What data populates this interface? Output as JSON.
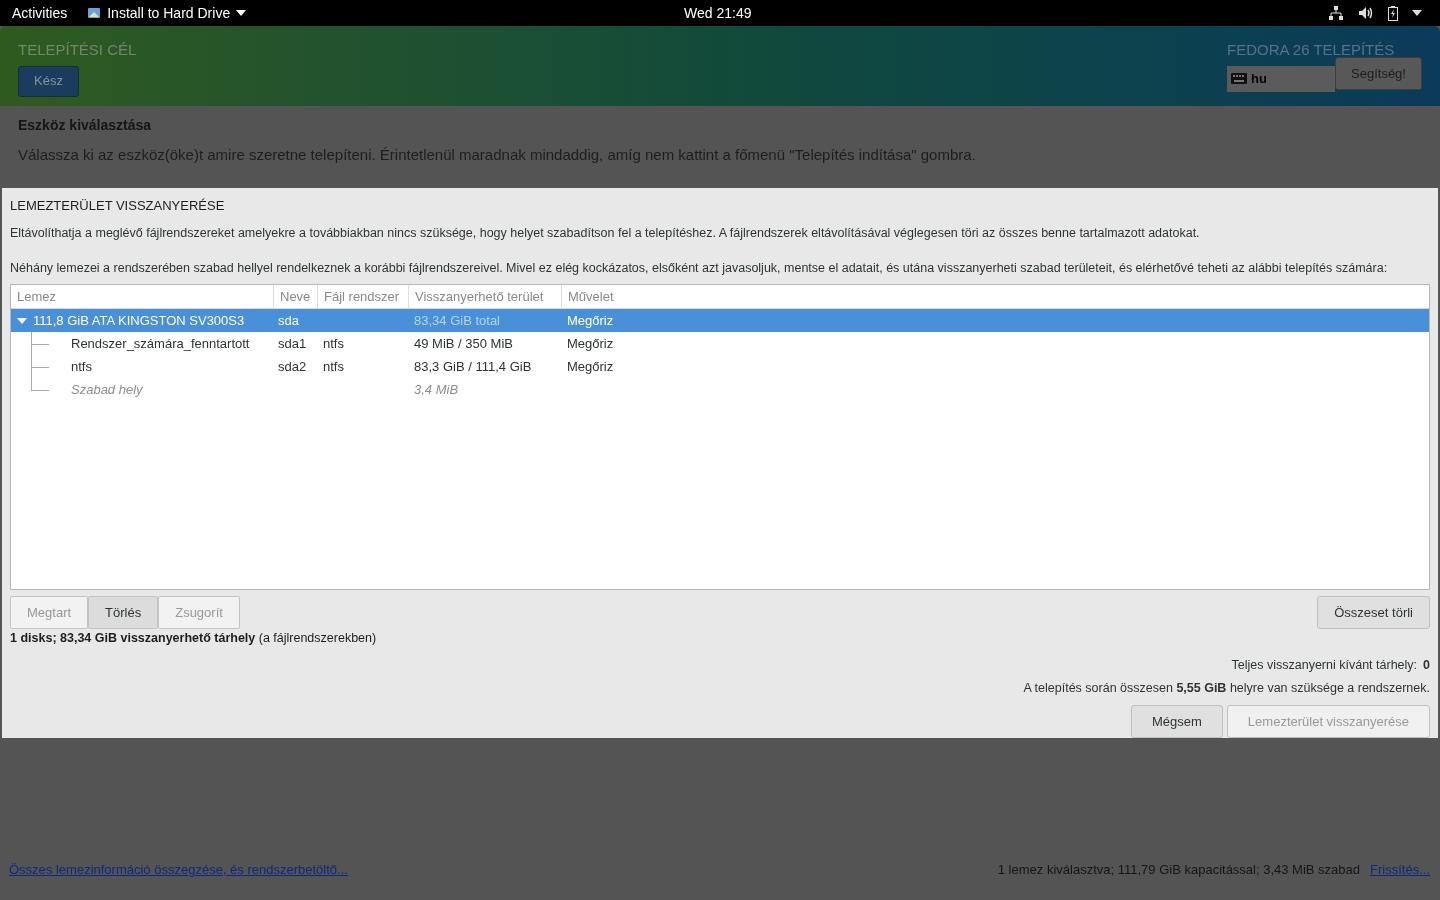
{
  "top_bar": {
    "activities": "Activities",
    "app_menu": "Install to Hard Drive",
    "clock": "Wed 21:49"
  },
  "header": {
    "title": "TELEPÍTÉSI CÉL",
    "done_button": "Kész",
    "product": "FEDORA 26 TELEPÍTÉS",
    "keyboard_layout": "hu",
    "help_button": "Segítség!"
  },
  "content": {
    "heading": "Eszköz kiválasztása",
    "description": "Válassza ki az eszköz(öke)t amire szeretne telepíteni. Érintetlenül maradnak mindaddig, amíg nem kattint a főmenü \"Telepítés indítása\" gombra."
  },
  "dialog": {
    "title": "LEMEZTERÜLET VISSZANYERÉSE",
    "paragraph_1": "Eltávolíthatja a meglévő fájlrendszereket amelyekre a továbbiakban nincs szüksége, hogy helyet szabadítson fel a telepítéshez. A fájlrendszerek eltávolításával véglegesen töri az összes benne tartalmazott adatokat.",
    "paragraph_2": "Néhány lemezei a rendszerében szabad hellyel rendelkeznek a korábbi fájlrendszereivel. Mivel ez elég kockázatos, elsőként azt javasoljuk, mentse el adatait, és utána visszanyerheti szabad területeit, és elérhetővé teheti az alábbi telepítés számára:",
    "table": {
      "columns": [
        "Lemez",
        "Neve",
        "Fájl rendszer",
        "Visszanyerhető terület",
        "Művelet"
      ],
      "rows": [
        {
          "disk": "111,8 GiB ATA KINGSTON SV300S3",
          "name": "sda",
          "reclaimable": "83,34 GiB total",
          "action": "Megőriz",
          "expanded": true,
          "selected": true,
          "children": [
            {
              "kind": "partition",
              "disk": "Rendszer_számára_fenntartott",
              "name": "sda1",
              "filesystem": "ntfs",
              "reclaimable": "49 MiB / 350 MiB",
              "action": "Megőriz",
              "selected": false
            },
            {
              "kind": "partition",
              "disk": "ntfs",
              "name": "sda2",
              "filesystem": "ntfs",
              "reclaimable": "83,3 GiB / 111,4 GiB",
              "action": "Megőriz",
              "selected": false
            },
            {
              "kind": "free",
              "disk": "Szabad hely",
              "reclaimable": "3,4 MiB",
              "selected": false
            }
          ]
        }
      ]
    },
    "actions": [
      {
        "label": "Megtart",
        "disabled": true
      },
      {
        "label": "Törlés",
        "disabled": false
      },
      {
        "label": "Zsugorít",
        "disabled": true
      }
    ],
    "delete_all_button": "Összeset törli",
    "summary": "**1 disks; 83,34 GiB visszanyerhető tárhely** (a fájlrendszerekben)",
    "total_label": "Teljes visszanyerni kívánt tárhely:",
    "total_value": "0",
    "required": "A telepítés során összesen **5,55 GiB** helyre van szüksége a rendszernek.",
    "buttons": [
      {
        "label": "Mégsem",
        "disabled": false
      },
      {
        "label": "Lemezterület visszanyerése",
        "disabled": true
      }
    ]
  },
  "footer": {
    "link": "Összes lemezinformáció összegzése, és rendszerbetöltő...",
    "status": "1 lemez kiválasztva; 111,79 GiB kapacitással; 3,43 MiB szabad",
    "refresh_link": "Frissítés..."
  }
}
